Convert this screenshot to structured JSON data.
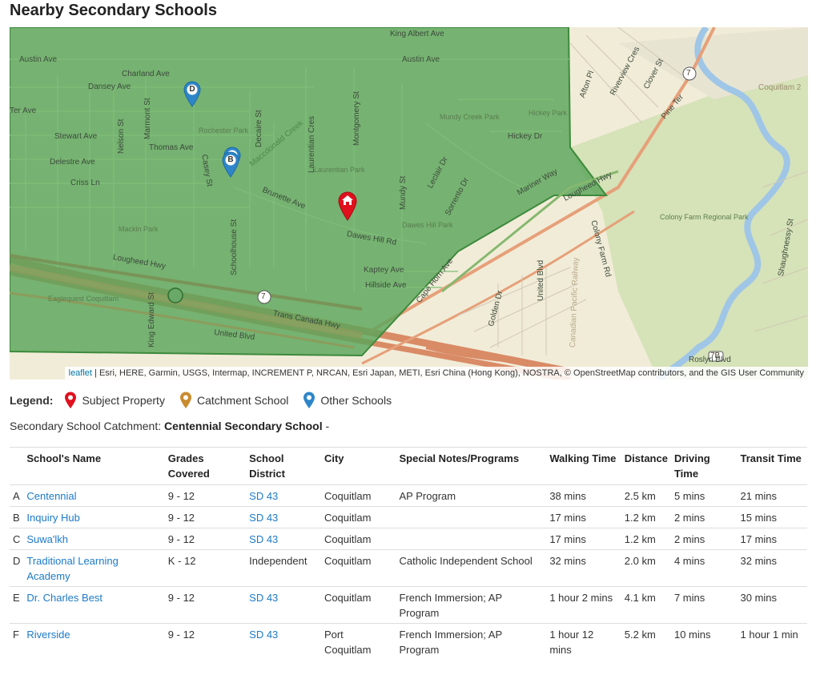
{
  "page_title": "Nearby Secondary Schools",
  "map": {
    "labels": [
      "King Albert Ave",
      "Austin Ave",
      "Charland Ave",
      "Dansey Ave",
      "Ter Ave",
      "Stewart Ave",
      "Thomas Ave",
      "Delestre Ave",
      "Criss Ln",
      "Brunette Ave",
      "Dawes Hill Rd",
      "Kaptey Ave",
      "Hillside Ave",
      "Lougheed Hwy",
      "Trans Canada Hwy",
      "United Blvd",
      "Schoolhouse St",
      "Decaire St",
      "Marmont St",
      "Nelson St",
      "Casey St",
      "Laurentian Cres",
      "Montgomery St",
      "Mundy St",
      "Leclair Dr",
      "Sorrento Dr",
      "Mariner Way",
      "Cape Horn Ave",
      "Golden Dr",
      "United Blvd",
      "Colony Farm Rd",
      "Canadian Pacific Railway",
      "Riverview Cres",
      "Clover St",
      "Pine Ter",
      "Afton Pl",
      "Shaughnessy St",
      "Coquitlam 2",
      "Hickey Dr",
      "Lougheed Hwy",
      "Eaglequest Coquitlam",
      "King Edward St",
      "Roslyn Blvd",
      "Maccdonald Creek"
    ],
    "parks": [
      "Rochester Park",
      "Laurentian Park",
      "Mundy Creek Park",
      "Hickey Park",
      "Dawes Hill Park",
      "Mackin Park",
      "Colony Farm Regional Park"
    ],
    "shields": [
      "7",
      "7",
      "7B",
      "1"
    ],
    "attribution_link": "leaflet",
    "attribution_text": " | Esri, HERE, Garmin, USGS, Intermap, INCREMENT P, NRCAN, Esri Japan, METI, Esri China (Hong Kong), NOSTRA, © OpenStreetMap contributors, and the GIS User Community",
    "markers": [
      {
        "letter": "D",
        "type": "other"
      },
      {
        "letter": "B",
        "type": "other"
      },
      {
        "letter": "",
        "type": "subject"
      }
    ],
    "colors": {
      "catchment_fill": "#5aa55a",
      "subject": "#e0101d",
      "catchment": "#c98b2f",
      "other": "#2e86c9"
    }
  },
  "legend": {
    "title": "Legend:",
    "items": [
      "Subject Property",
      "Catchment School",
      "Other Schools"
    ]
  },
  "catchment": {
    "label": "Secondary School Catchment: ",
    "school": "Centennial Secondary School",
    "suffix": " -"
  },
  "table": {
    "headers": [
      "School's Name",
      "Grades Covered",
      "School District",
      "City",
      "Special Notes/Programs",
      "Walking Time",
      "Distance",
      "Driving Time",
      "Transit Time"
    ],
    "rows": [
      {
        "letter": "A",
        "name": "Centennial",
        "grades": "9 - 12",
        "district": "SD 43",
        "district_link": true,
        "city": "Coquitlam",
        "notes": "AP Program",
        "walking": "38 mins",
        "distance": "2.5 km",
        "driving": "5 mins",
        "transit": "21 mins"
      },
      {
        "letter": "B",
        "name": "Inquiry Hub",
        "grades": "9 - 12",
        "district": "SD 43",
        "district_link": true,
        "city": "Coquitlam",
        "notes": "",
        "walking": "17 mins",
        "distance": "1.2 km",
        "driving": "2 mins",
        "transit": "15 mins"
      },
      {
        "letter": "C",
        "name": "Suwa'lkh",
        "grades": "9 - 12",
        "district": "SD 43",
        "district_link": true,
        "city": "Coquitlam",
        "notes": "",
        "walking": "17 mins",
        "distance": "1.2 km",
        "driving": "2 mins",
        "transit": "17 mins"
      },
      {
        "letter": "D",
        "name": "Traditional Learning Academy",
        "grades": "K - 12",
        "district": "Independent",
        "district_link": false,
        "city": "Coquitlam",
        "notes": "Catholic Independent School",
        "walking": "32 mins",
        "distance": "2.0 km",
        "driving": "4 mins",
        "transit": "32 mins"
      },
      {
        "letter": "E",
        "name": "Dr. Charles Best",
        "grades": "9 - 12",
        "district": "SD 43",
        "district_link": true,
        "city": "Coquitlam",
        "notes": "French Immersion; AP Program",
        "walking": "1 hour 2 mins",
        "distance": "4.1 km",
        "driving": "7 mins",
        "transit": "30 mins"
      },
      {
        "letter": "F",
        "name": "Riverside",
        "grades": "9 - 12",
        "district": "SD 43",
        "district_link": true,
        "city": "Port Coquitlam",
        "notes": "French Immersion; AP Program",
        "walking": "1 hour 12 mins",
        "distance": "5.2 km",
        "driving": "10 mins",
        "transit": "1 hour 1 min"
      }
    ]
  }
}
